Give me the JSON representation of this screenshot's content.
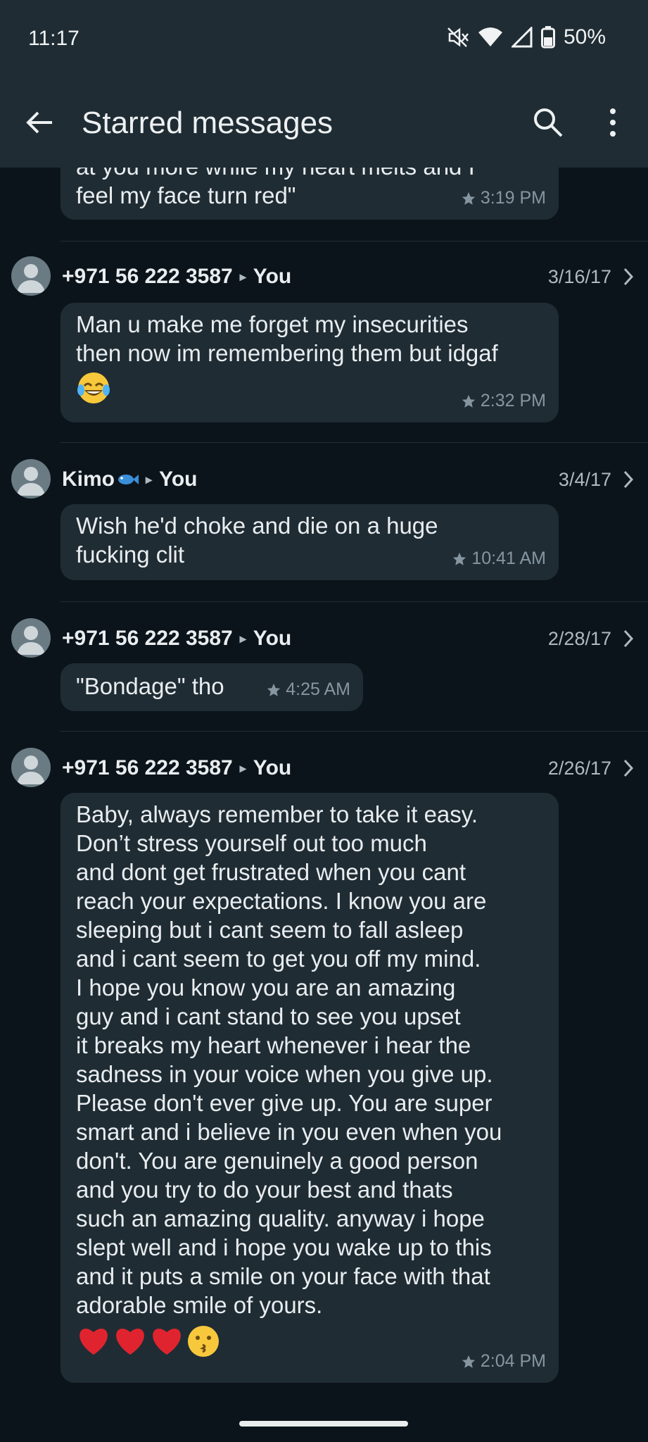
{
  "status": {
    "time": "11:17",
    "battery": "50%"
  },
  "appbar": {
    "title": "Starred messages"
  },
  "messages": [
    {
      "text": "at you more while my heart melts and I\nfeel my face turn red\"",
      "time": "3:19 PM"
    },
    {
      "sender": "+971 56 222 3587",
      "to": "You",
      "date": "3/16/17",
      "text": "Man u make me forget my insecurities\nthen now im remembering them but idgaf",
      "emoji": "tears-of-joy",
      "time": "2:32 PM"
    },
    {
      "sender": "Kimo",
      "sender_emoji": "fish",
      "to": "You",
      "date": "3/4/17",
      "text": "Wish he'd choke and die on a huge\nfucking clit",
      "time": "10:41 AM"
    },
    {
      "sender": "+971 56 222 3587",
      "to": "You",
      "date": "2/28/17",
      "text": "\"Bondage\" tho",
      "time": "4:25 AM"
    },
    {
      "sender": "+971 56 222 3587",
      "to": "You",
      "date": "2/26/17",
      "text": "Baby, always remember to take it easy.\nDon’t stress yourself out too much\nand dont get frustrated when you cant\nreach your expectations. I know you are\nsleeping but i cant seem to fall asleep\nand i cant seem to get you off my mind.\nI hope you know you are an amazing\nguy and i cant stand to see you upset\nit breaks my heart whenever i hear the\nsadness in your voice when you give up.\nPlease don't ever give up. You are super\nsmart and i believe in you even when you\ndon't. You are genuinely a good person\nand you try to do your best and thats\nsuch an amazing quality. anyway i hope\nslept well and i hope you wake up to this\nand it puts a smile on your face with that\nadorable smile of yours.",
      "emojis": [
        "red-heart",
        "red-heart",
        "red-heart",
        "kissing-face"
      ],
      "time": "2:04 PM"
    }
  ]
}
